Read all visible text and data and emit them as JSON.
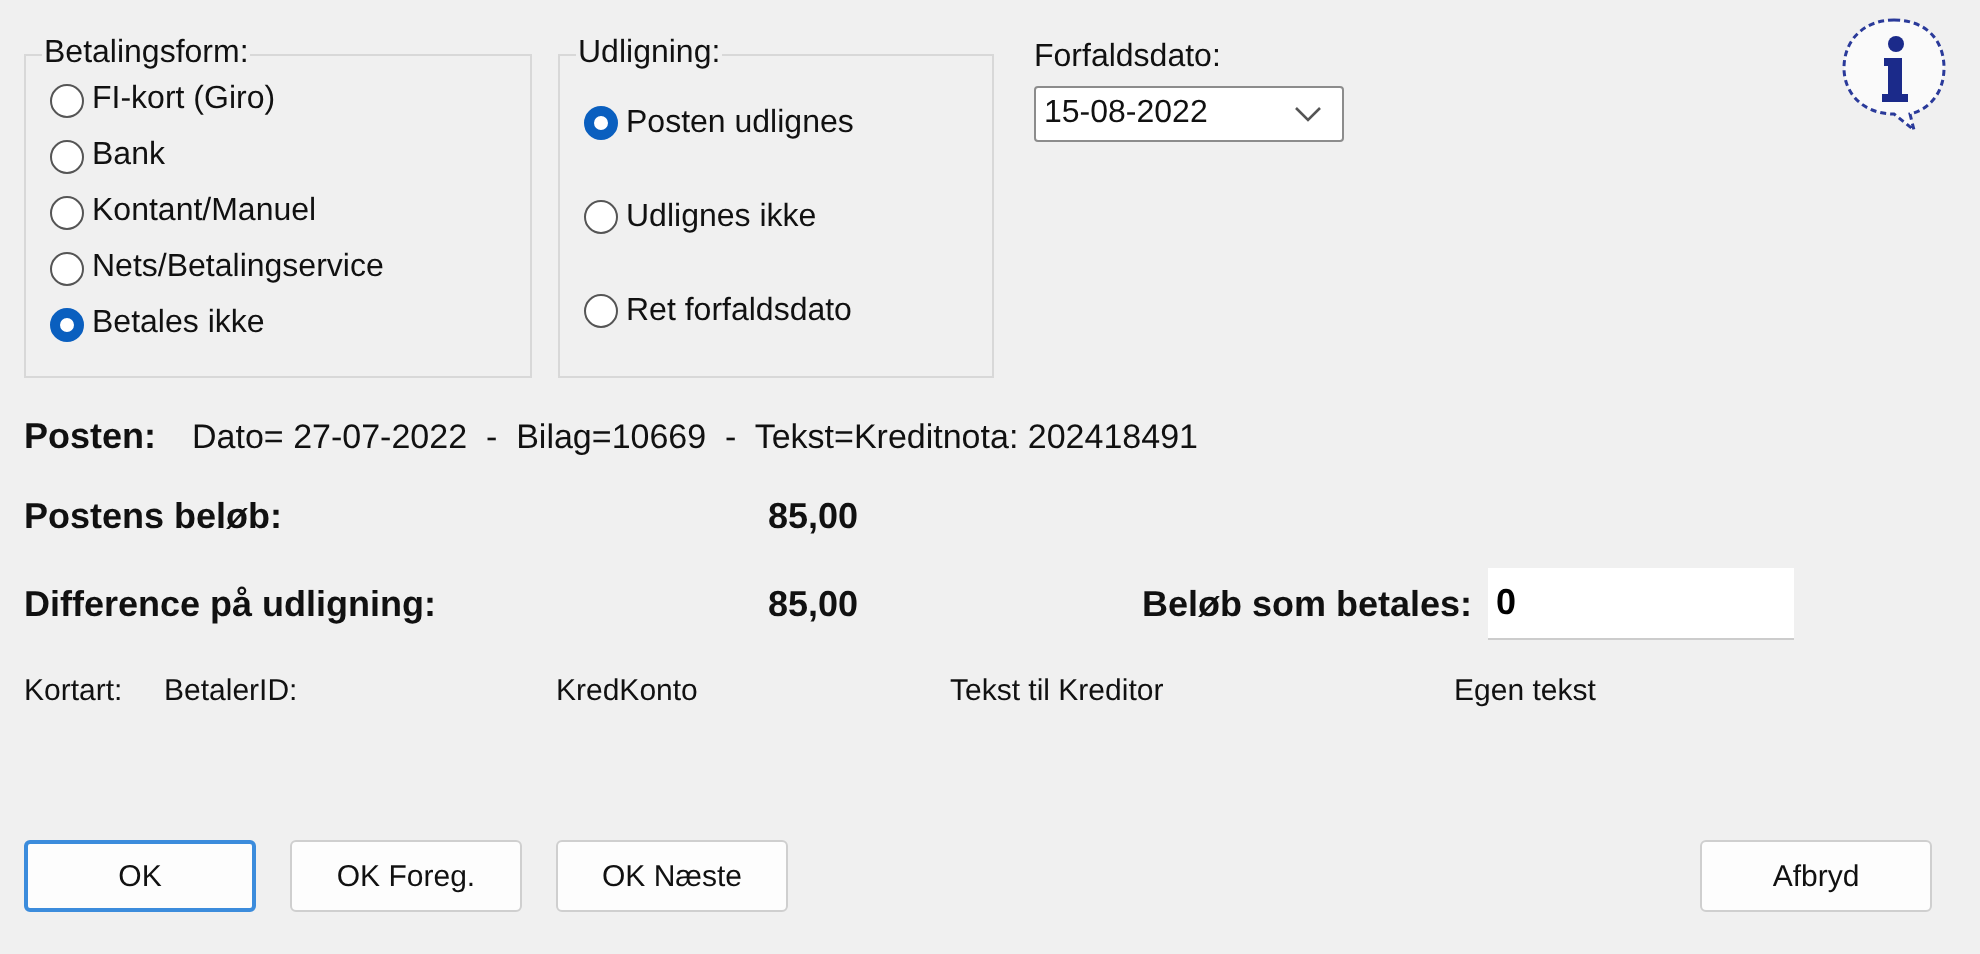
{
  "payment_method": {
    "legend": "Betalingsform:",
    "options": [
      {
        "label": "FI-kort (Giro)",
        "selected": false
      },
      {
        "label": "Bank",
        "selected": false
      },
      {
        "label": "Kontant/Manuel",
        "selected": false
      },
      {
        "label": "Nets/Betalingservice",
        "selected": false
      },
      {
        "label": "Betales ikke",
        "selected": true
      }
    ]
  },
  "settlement": {
    "legend": "Udligning:",
    "options": [
      {
        "label": "Posten udlignes",
        "selected": true
      },
      {
        "label": "Udlignes ikke",
        "selected": false
      },
      {
        "label": "Ret forfaldsdato",
        "selected": false
      }
    ]
  },
  "due_date": {
    "label": "Forfaldsdato:",
    "value": "15-08-2022"
  },
  "entry": {
    "label": "Posten:",
    "text": "Dato= 27-07-2022  -  Bilag=10669  -  Tekst=Kreditnota: 202418491"
  },
  "entry_amount": {
    "label": "Postens beløb:",
    "value": "85,00"
  },
  "difference": {
    "label": "Difference på udligning:",
    "value": "85,00"
  },
  "amount_to_pay": {
    "label": "Beløb som betales:",
    "value": "0"
  },
  "details": [
    "Kortart:",
    "BetalerID:",
    "KredKonto",
    "Tekst til Kreditor",
    "Egen tekst"
  ],
  "buttons": [
    {
      "label": "OK",
      "default": true
    },
    {
      "label": "OK Foreg.",
      "default": false
    },
    {
      "label": "OK Næste",
      "default": false
    },
    {
      "label": "Afbryd",
      "default": false
    }
  ]
}
